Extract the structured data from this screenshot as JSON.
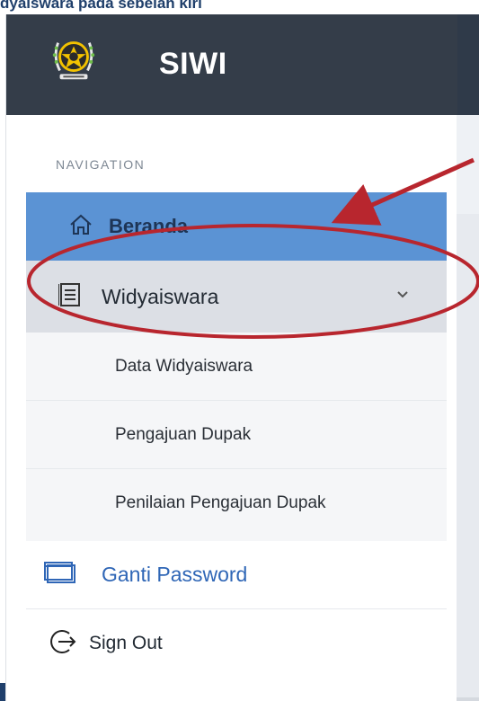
{
  "caption": {
    "text": "dyaiswara pada sebelah kiri"
  },
  "brand": {
    "name": "SIWI",
    "logo": "emblem-logo"
  },
  "navigation": {
    "section_label": "NAVIGATION",
    "items": [
      {
        "label": "Beranda",
        "icon": "home-icon",
        "active": true
      },
      {
        "label": "Widyaiswara",
        "icon": "list-icon",
        "expanded": true,
        "submenu": [
          {
            "label": "Data Widyaiswara"
          },
          {
            "label": "Pengajuan Dupak"
          },
          {
            "label": "Penilaian Pengajuan Dupak"
          }
        ]
      },
      {
        "label": "Ganti Password",
        "icon": "window-icon"
      },
      {
        "label": "Sign Out",
        "icon": "sign-out-icon"
      }
    ]
  },
  "colors": {
    "header_bg": "#343d49",
    "active_item": "#5b93d4",
    "expanded_item": "#dcdfe5",
    "submenu_bg": "#f5f6f8",
    "annotation": "#b8262e",
    "caption": "#1f3f6b"
  }
}
